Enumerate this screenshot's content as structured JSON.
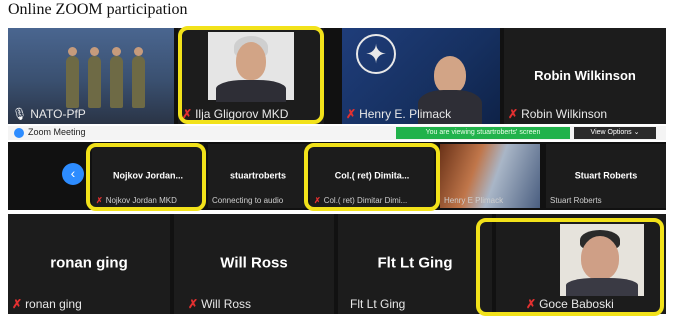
{
  "caption": "Online ZOOM participation",
  "row1": [
    {
      "display_name": "",
      "label": "NATO-PfP",
      "muted": false
    },
    {
      "display_name": "",
      "label": "Ilja Gligorov MKD",
      "muted": true
    },
    {
      "display_name": "",
      "label": "Henry E. Plimack",
      "muted": true
    },
    {
      "display_name": "Robin Wilkinson",
      "label": "Robin Wilkinson",
      "muted": true
    }
  ],
  "zoom_bar": {
    "title": "Zoom Meeting",
    "banner": "You are viewing stuartroberts' screen",
    "view_options": "View Options ⌄"
  },
  "row2": [
    {
      "display_name": "Nojkov Jordan...",
      "label": "Nojkov Jordan MKD",
      "muted": true
    },
    {
      "display_name": "stuartroberts",
      "label": "Connecting to audio",
      "muted": false
    },
    {
      "display_name": "Col.( ret) Dimita...",
      "label": "Col.( ret) Dimitar Dimi...",
      "muted": true
    },
    {
      "display_name": "",
      "label": "Henry E Plimack",
      "muted": false
    },
    {
      "display_name": "Stuart Roberts",
      "label": "Stuart Roberts",
      "muted": false
    }
  ],
  "row3": [
    {
      "display_name": "ronan ging",
      "label": "ronan ging",
      "muted": true
    },
    {
      "display_name": "Will Ross",
      "label": "Will Ross",
      "muted": true
    },
    {
      "display_name": "Flt Lt Ging",
      "label": "Flt Lt Ging",
      "muted": false
    },
    {
      "display_name": "",
      "label": "Goce Baboski",
      "muted": true
    }
  ],
  "icons": {
    "mic_muted": "muted-mic-icon",
    "mic": "mic-icon",
    "prev": "chevron-left-icon"
  },
  "colors": {
    "highlight": "#f2e21a",
    "zoom_blue": "#2d8cff",
    "banner_green": "#21b24b",
    "muted_red": "#e23030"
  }
}
